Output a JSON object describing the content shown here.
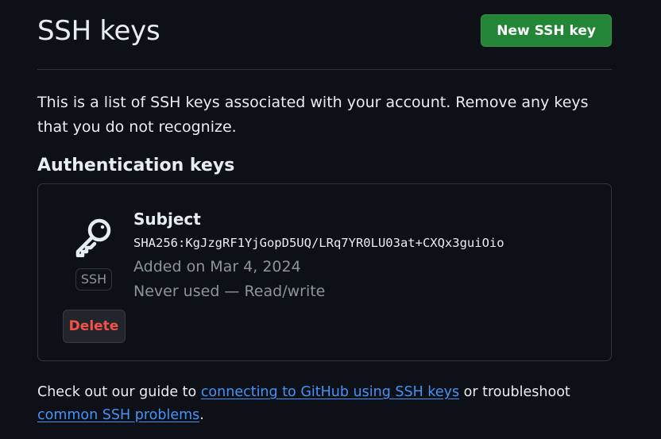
{
  "header": {
    "title": "SSH keys",
    "new_button_label": "New SSH key"
  },
  "description": "This is a list of SSH keys associated with your account. Remove any keys that you do not recognize.",
  "section": {
    "title": "Authentication keys"
  },
  "key": {
    "icon": "key-icon",
    "badge": "SSH",
    "delete_label": "Delete",
    "subject": "Subject",
    "fingerprint": "SHA256:KgJzgRF1YjGopD5UQ/LRq7YR0LU03at+CXQx3guiOio",
    "added": "Added on Mar 4, 2024",
    "usage": "Never used — Read/write"
  },
  "footer": {
    "text_1": "Check out our guide to ",
    "link_1": "connecting to GitHub using SSH keys",
    "text_2": " or troubleshoot ",
    "link_2": "common SSH problems",
    "text_3": "."
  },
  "colors": {
    "background": "#0d1117",
    "primary_button": "#238636",
    "danger_text": "#f85149",
    "link": "#4493f8",
    "muted_text": "#8b949e",
    "border": "#30363d"
  }
}
